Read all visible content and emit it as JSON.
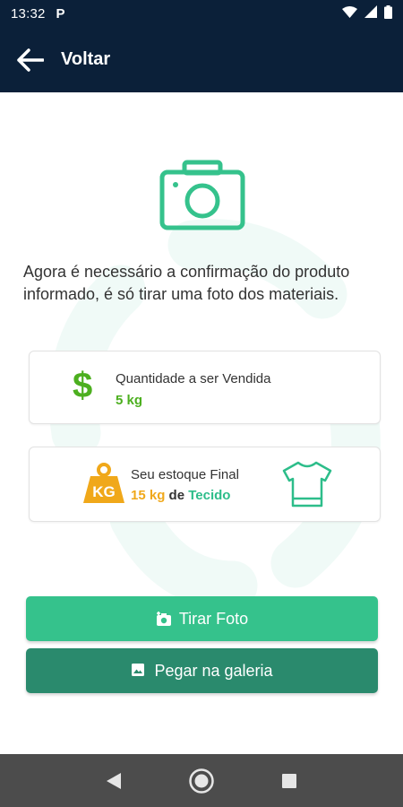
{
  "status_bar": {
    "time": "13:32",
    "app_indicator": "P",
    "icons": [
      "wifi-icon",
      "signal-icon",
      "battery-icon"
    ]
  },
  "app_bar": {
    "title": "Voltar",
    "back_icon": "arrow-left-icon"
  },
  "main": {
    "illustration_icon": "camera-outline-icon",
    "instructions": "Agora é necessário a confirmação do produto informado, é só tirar uma foto dos materiais.",
    "quantity_card": {
      "icon": "dollar-icon",
      "icon_glyph": "$",
      "label": "Quantidade a ser Vendida",
      "value": "5 kg"
    },
    "stock_card": {
      "icon": "kg-weight-icon",
      "icon_text": "KG",
      "label": "Seu estoque Final",
      "value": "15 kg",
      "connector": "de",
      "material": "Tecido",
      "material_icon": "tshirt-icon"
    },
    "buttons": {
      "take_photo": "Tirar Foto",
      "gallery": "Pegar na galeria"
    }
  },
  "nav_bar": {
    "icons": [
      "back-triangle-icon",
      "home-circle-icon",
      "recents-square-icon"
    ]
  },
  "colors": {
    "header": "#0b2039",
    "accent_green": "#35c28c",
    "dark_green": "#2a8a6d",
    "value_green": "#4caf1f",
    "kg_orange": "#f0a81a",
    "material_teal": "#2dbd8a",
    "nav_bar": "#4c4c4c"
  }
}
